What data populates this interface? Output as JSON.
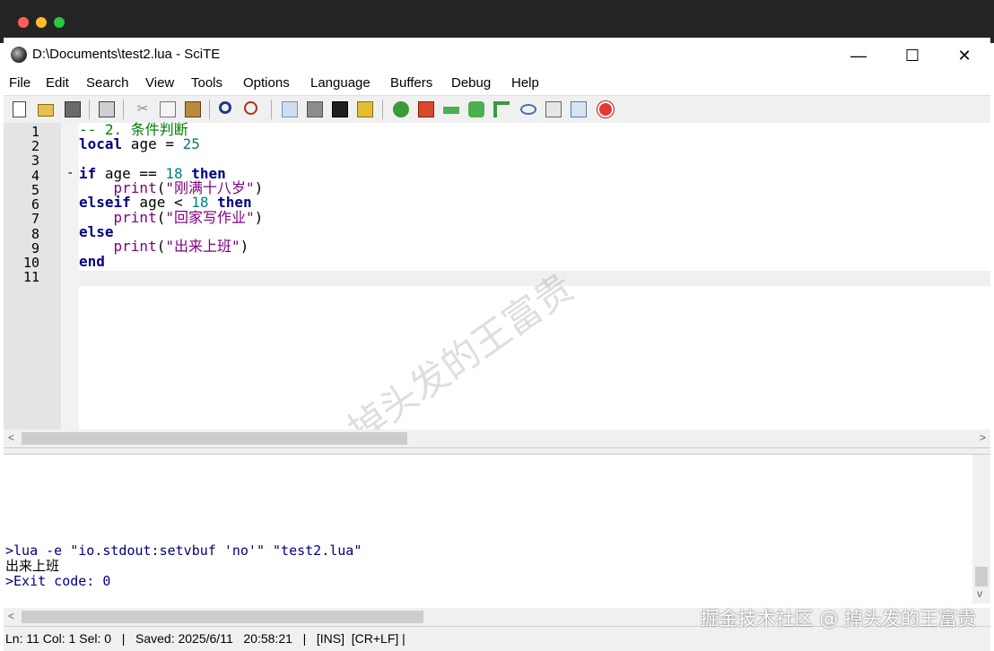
{
  "window": {
    "title": "D:\\Documents\\test2.lua - SciTE",
    "controls": {
      "minimize": "—",
      "maximize": "☐",
      "close": "✕"
    }
  },
  "menu": [
    "File",
    "Edit",
    "Search",
    "View",
    "Tools",
    "Options",
    "Language",
    "Buffers",
    "Debug",
    "Help"
  ],
  "toolbar": [
    "new-file-icon",
    "open-file-icon",
    "save-icon",
    "print-icon",
    "cut-icon",
    "copy-icon",
    "paste-icon",
    "find-icon",
    "replace-icon",
    "go-icon",
    "stop-icon",
    "terminal-icon",
    "build-icon",
    "debug-bug-icon",
    "debug-run-icon",
    "step-over-icon",
    "step-into-icon",
    "step-out-icon",
    "watch-icon",
    "calculator-icon",
    "export-icon",
    "record-icon"
  ],
  "editor": {
    "line_numbers": [
      "1",
      "2",
      "3",
      "4",
      "5",
      "6",
      "7",
      "8",
      "9",
      "10",
      "11"
    ],
    "current_line": 11,
    "fold_marker": "-"
  },
  "code": {
    "l1_comment": "-- 2. 条件判断",
    "l2_kw": "local",
    "l2_rest": " age = ",
    "l2_num": "25",
    "l4_kw1": "if",
    "l4_mid": " age == ",
    "l4_num": "18",
    "l4_kw2": " then",
    "l5_indent": "    ",
    "l5_fn": "print",
    "l5_open": "(",
    "l5_str": "\"刚满十八岁\"",
    "l5_close": ")",
    "l6_kw1": "elseif",
    "l6_mid": " age < ",
    "l6_num": "18",
    "l6_kw2": " then",
    "l7_str": "\"回家写作业\"",
    "l8_kw": "else",
    "l9_str": "\"出来上班\"",
    "l10_kw": "end"
  },
  "output": {
    "command": ">lua -e \"io.stdout:setvbuf 'no'\" \"test2.lua\"",
    "result": "出来上班",
    "exit": ">Exit code: 0"
  },
  "status": "Ln: 11 Col: 1 Sel: 0   |   Saved: 2025/6/11   20:58:21   |   [INS]  [CR+LF] |",
  "watermark": "掉头发的王富贵",
  "corner_watermark": "掘金技术社区 @ 掉头发的王富贵",
  "colors": {
    "keyword": "#00007f",
    "comment": "#007f00",
    "number": "#007f7f",
    "string": "#7f007f"
  }
}
